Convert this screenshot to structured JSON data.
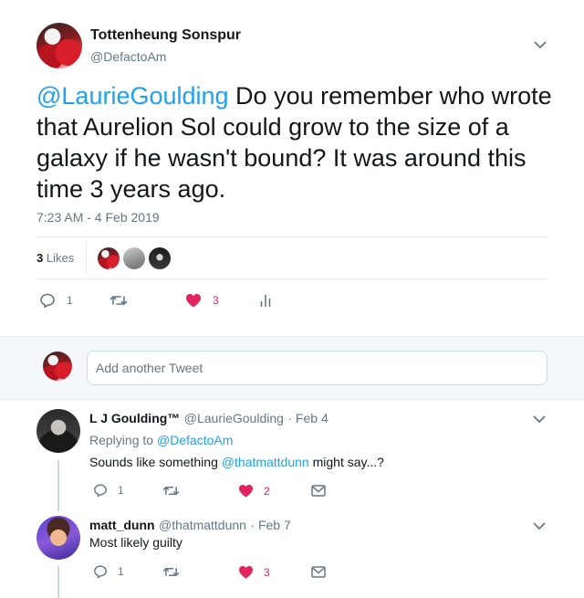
{
  "main_tweet": {
    "author_name": "Tottenheung Sonspur",
    "author_handle": "@DefactoAm",
    "mention": "@LaurieGoulding",
    "text": " Do you remember who wrote that Aurelion Sol could grow to the size of a galaxy if he wasn't bound? It was around this time 3 years ago.",
    "timestamp": "7:23 AM - 4 Feb 2019",
    "likes_count": "3",
    "likes_label": "Likes",
    "replies": "1",
    "retweets": "",
    "likes": "3"
  },
  "compose": {
    "placeholder": "Add another Tweet"
  },
  "replies": [
    {
      "name": "L J Goulding™",
      "handle": "@LaurieGoulding",
      "date": "· Feb 4",
      "replying_prefix": "Replying to ",
      "replying_to": "@DefactoAm",
      "text_before": "Sounds like something ",
      "text_mention": "@thatmattdunn",
      "text_after": " might say...?",
      "replies": "1",
      "likes": "2"
    },
    {
      "name": "matt_dunn",
      "handle": "@thatmattdunn",
      "date": "· Feb 7",
      "text": "Most likely guilty",
      "replies": "1",
      "likes": "3"
    }
  ],
  "colors": {
    "accent": "#1da1f2",
    "like": "#e0245e",
    "muted": "#657786"
  }
}
